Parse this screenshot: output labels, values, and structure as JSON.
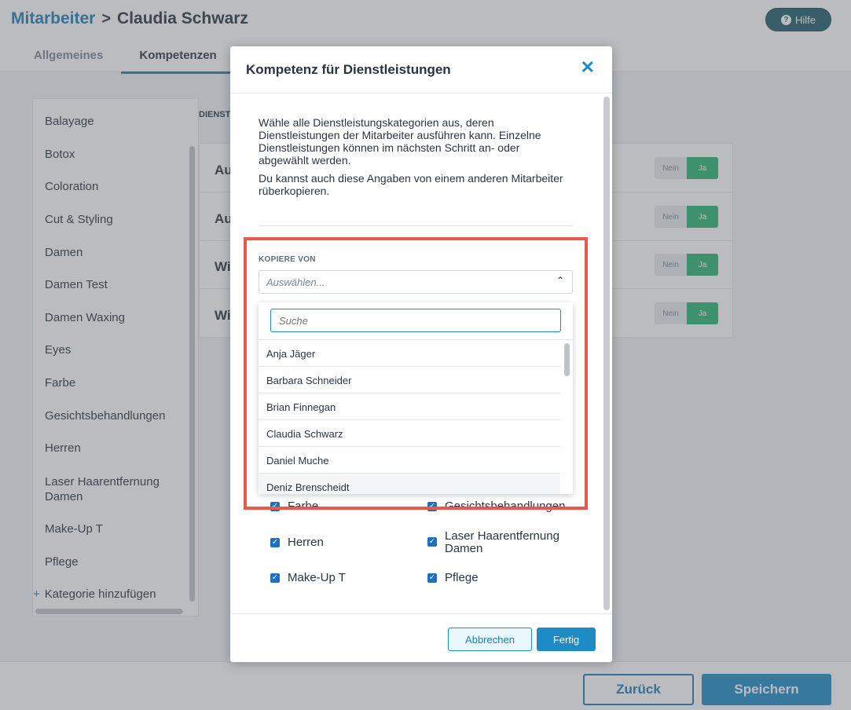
{
  "breadcrumb": {
    "parent": "Mitarbeiter",
    "separator": ">",
    "current": "Claudia Schwarz"
  },
  "help": {
    "label": "Hilfe",
    "icon": "question-circle-icon"
  },
  "tabs": [
    {
      "label": "Allgemeines"
    },
    {
      "label": "Kompetenzen"
    }
  ],
  "sidebar": {
    "items": [
      "Balayage",
      "Botox",
      "Coloration",
      "Cut & Styling",
      "Damen",
      "Damen Test",
      "Damen Waxing",
      "Eyes",
      "Farbe",
      "Gesichtsbehandlungen",
      "Herren",
      "Laser Haarentfernung Damen",
      "Make-Up T",
      "Pflege"
    ],
    "add_label": "Kategorie hinzufügen"
  },
  "content": {
    "header": "DIENST",
    "rows": [
      {
        "title": "Au",
        "no": "Nein",
        "yes": "Ja"
      },
      {
        "title": "Au",
        "no": "Nein",
        "yes": "Ja"
      },
      {
        "title": "Wi",
        "no": "Nein",
        "yes": "Ja"
      },
      {
        "title": "Wi",
        "no": "Nein",
        "yes": "Ja"
      }
    ]
  },
  "footer": {
    "back_label": "Zurück",
    "save_label": "Speichern"
  },
  "modal": {
    "title": "Kompetenz für Dienstleistungen",
    "close_icon": "close-icon",
    "intro_1": "Wähle alle Dienstleistungskategorien aus, deren Dienstleistungen der Mitarbeiter ausführen kann. Einzelne Dienstleistungen können im nächsten Schritt an- oder abgewählt werden.",
    "intro_2": "Du kannst auch diese Angaben von einem anderen Mitarbeiter rüberkopieren.",
    "copy_label": "KOPIERE VON",
    "select_placeholder": "Auswählen...",
    "search_placeholder": "Suche",
    "options": [
      "Anja Jäger",
      "Barbara Schneider",
      "Brian Finnegan",
      "Claudia Schwarz",
      "Daniel Muche",
      "Deniz Brenscheidt"
    ],
    "checkboxes": [
      {
        "label": "Farbe",
        "checked": true
      },
      {
        "label": "Gesichtsbehandlungen",
        "checked": true
      },
      {
        "label": "Herren",
        "checked": true
      },
      {
        "label": "Laser Haarentfernung Damen",
        "checked": true
      },
      {
        "label": "Make-Up T",
        "checked": true
      },
      {
        "label": "Pflege",
        "checked": true
      }
    ],
    "cancel_label": "Abbrechen",
    "done_label": "Fertig"
  },
  "colors": {
    "accent": "#1d8bc6",
    "success": "#2bb673",
    "highlight": "#e8594b"
  }
}
